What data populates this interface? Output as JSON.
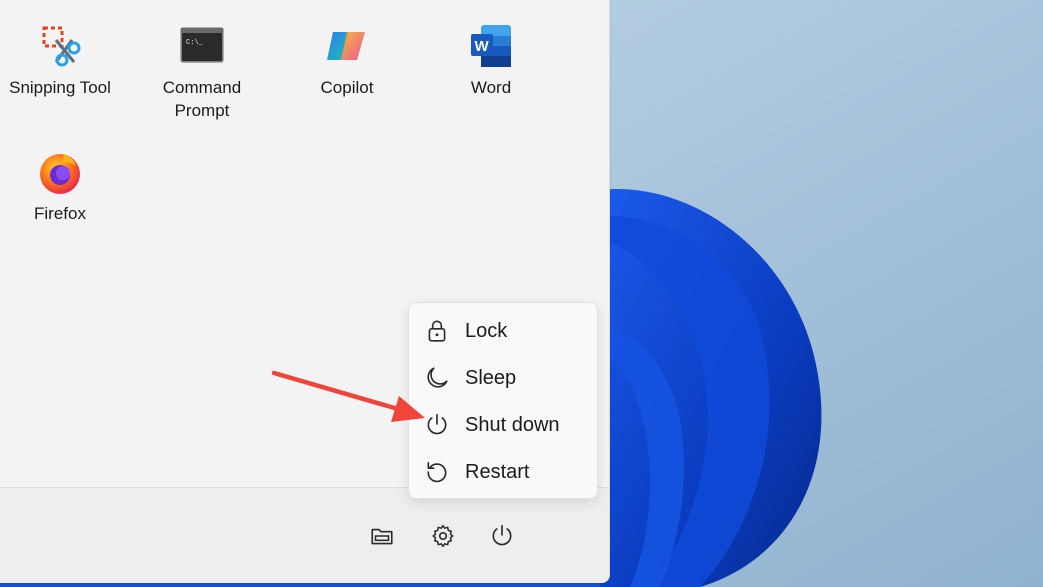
{
  "start_menu": {
    "pinned_apps": [
      {
        "label": "Snipping Tool",
        "icon": "snipping-tool-icon"
      },
      {
        "label": "Command\nPrompt",
        "icon": "command-prompt-icon"
      },
      {
        "label": "Copilot",
        "icon": "copilot-icon"
      },
      {
        "label": "Word",
        "icon": "word-icon"
      },
      {
        "label": "Firefox",
        "icon": "firefox-icon"
      }
    ],
    "footer": {
      "buttons": [
        "file-explorer-icon",
        "gear-icon",
        "power-icon"
      ]
    }
  },
  "power_menu": {
    "items": [
      {
        "label": "Lock",
        "icon": "lock-icon"
      },
      {
        "label": "Sleep",
        "icon": "moon-icon"
      },
      {
        "label": "Shut down",
        "icon": "power-icon"
      },
      {
        "label": "Restart",
        "icon": "restart-icon"
      }
    ]
  },
  "colors": {
    "annotation_arrow": "#f0453a",
    "wallpaper_bloom": "#0b3fc4",
    "wallpaper_bg": "#a9c4dc"
  }
}
